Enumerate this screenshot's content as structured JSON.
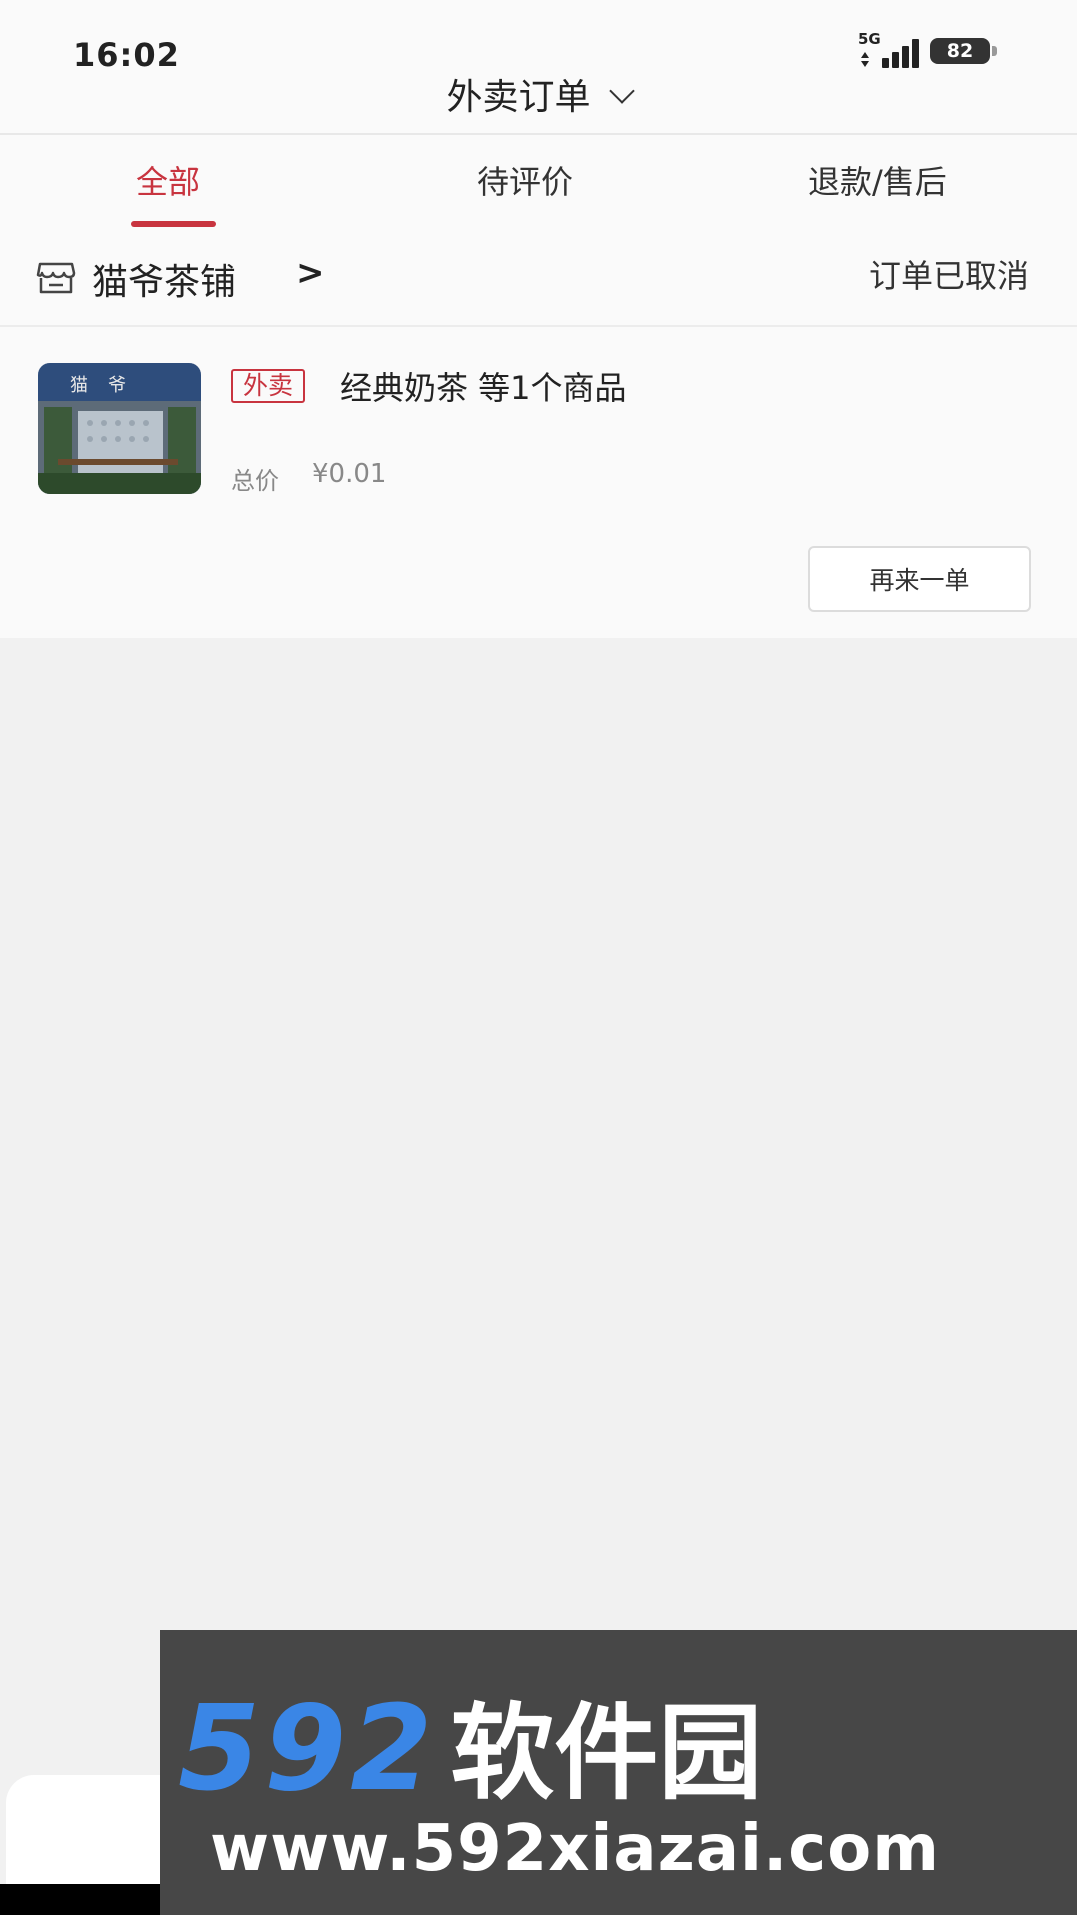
{
  "status_bar": {
    "time": "16:02",
    "network": "5G",
    "battery": "82"
  },
  "header": {
    "title": "外卖订单"
  },
  "tabs": [
    {
      "label": "全部",
      "active": true
    },
    {
      "label": "待评价",
      "active": false
    },
    {
      "label": "退款/售后",
      "active": false
    }
  ],
  "order": {
    "shop_name": "猫爷茶铺",
    "shop_arrow": ">",
    "status": "订单已取消",
    "tag": "外卖",
    "item_title": "经典奶茶 等1个商品",
    "total_label": "总价",
    "total_value": "¥0.01",
    "reorder_label": "再来一单"
  },
  "watermark": {
    "number": "592",
    "brand": "软件园",
    "url": "www.592xiazai.com"
  },
  "colors": {
    "accent": "#c8343f",
    "watermark_blue": "#3a86e6",
    "watermark_bg": "#474747"
  }
}
